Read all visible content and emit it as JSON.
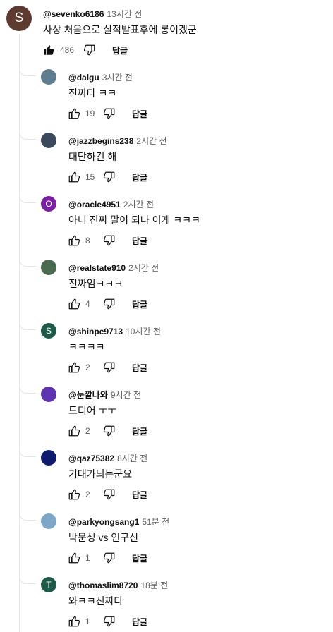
{
  "top_comment": {
    "avatar_letter": "S",
    "avatar_color": "#5d3b30",
    "handle": "@sevenko6186",
    "time": "13시간 전",
    "text": "사상 처음으로 실적발표후에 롱이겠군",
    "likes": "486",
    "reply_label": "답글"
  },
  "replies": [
    {
      "handle": "@dalgu",
      "time": "3시간 전",
      "text": "진짜다 ㅋㅋ",
      "likes": "19",
      "reply_label": "답글",
      "avatar_letter": "",
      "avatar_color": "#5f7d8e"
    },
    {
      "handle": "@jazzbegins238",
      "time": "2시간 전",
      "text": "대단하긴 해",
      "likes": "15",
      "reply_label": "답글",
      "avatar_letter": "",
      "avatar_color": "#3a4a5c"
    },
    {
      "handle": "@oracle4951",
      "time": "2시간 전",
      "text": "아니 진짜 말이 되나 이게 ㅋㅋㅋ",
      "likes": "8",
      "reply_label": "답글",
      "avatar_letter": "O",
      "avatar_color": "#7b1fa2"
    },
    {
      "handle": "@realstate910",
      "time": "2시간 전",
      "text": "진짜임ㅋㅋㅋ",
      "likes": "4",
      "reply_label": "답글",
      "avatar_letter": "",
      "avatar_color": "#4a6b4f"
    },
    {
      "handle": "@shinpe9713",
      "time": "10시간 전",
      "text": "ㅋㅋㅋㅋ",
      "likes": "2",
      "reply_label": "답글",
      "avatar_letter": "S",
      "avatar_color": "#1e5a4a"
    },
    {
      "handle": "@눈깔나와",
      "time": "9시간 전",
      "text": "드디어 ㅜㅜ",
      "likes": "2",
      "reply_label": "답글",
      "avatar_letter": "",
      "avatar_color": "#5e35b1"
    },
    {
      "handle": "@qaz75382",
      "time": "8시간 전",
      "text": "기대가되는군요",
      "likes": "2",
      "reply_label": "답글",
      "avatar_letter": "",
      "avatar_color": "#0d1a6e"
    },
    {
      "handle": "@parkyongsang1",
      "time": "51분 전",
      "text": "박문성 vs 인구신",
      "likes": "1",
      "reply_label": "답글",
      "avatar_letter": "",
      "avatar_color": "#7ea6c8"
    },
    {
      "handle": "@thomaslim8720",
      "time": "18분 전",
      "text": "와ㅋㅋ진짜다",
      "likes": "1",
      "reply_label": "답글",
      "avatar_letter": "T",
      "avatar_color": "#1e5a4a"
    }
  ]
}
